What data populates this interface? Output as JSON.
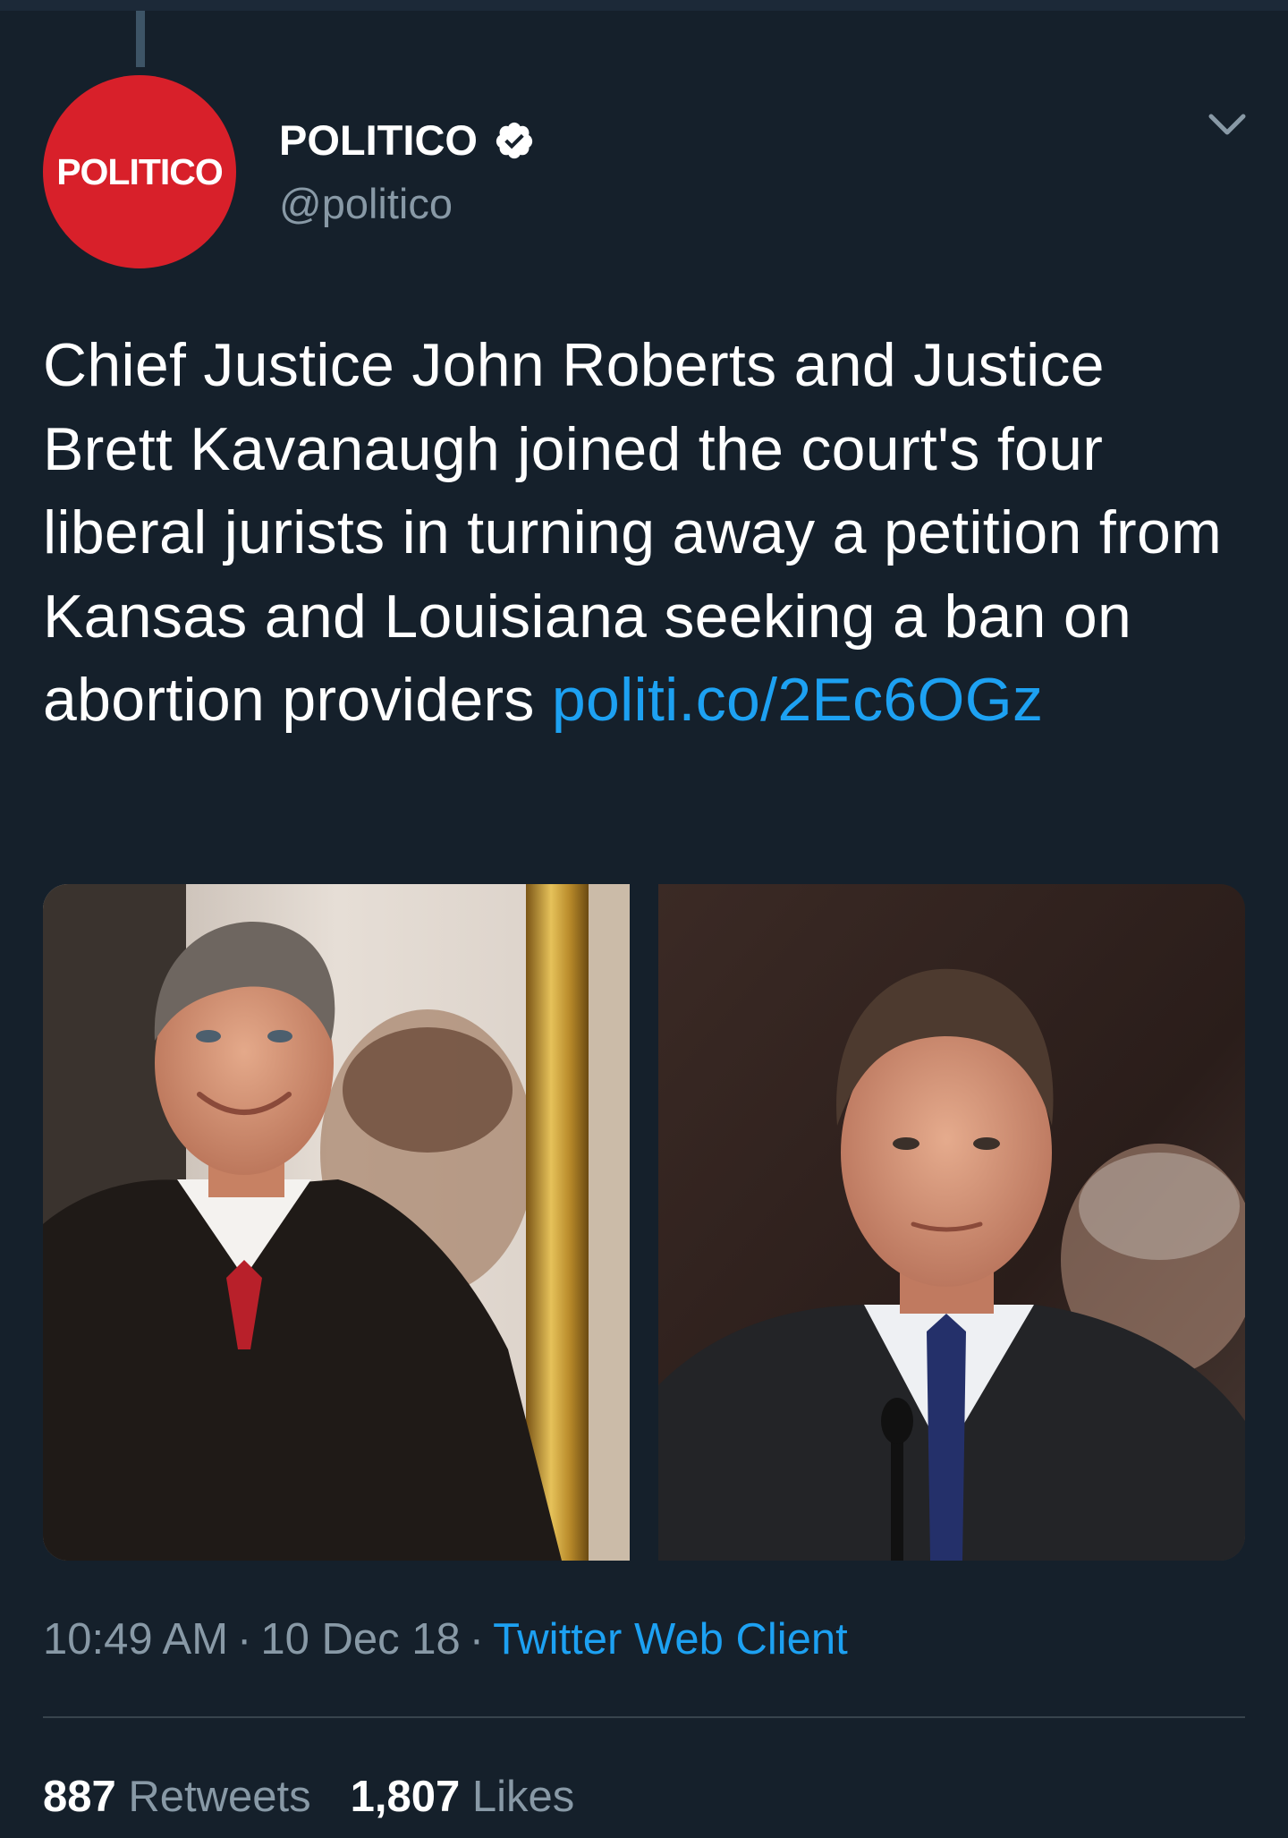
{
  "author": {
    "avatar_text": "POLITICO",
    "name": "POLITICO",
    "handle": "@politico",
    "verified": true
  },
  "tweet": {
    "text": "Chief Justice John Roberts and Justice Brett Kavanaugh joined the court's four liberal jurists in turning away a petition from Kansas and Louisiana seeking a ban on abortion providers ",
    "link": "politi.co/2Ec6OGz"
  },
  "media": [
    {
      "alt": "photo-john-roberts"
    },
    {
      "alt": "photo-brett-kavanaugh"
    }
  ],
  "meta": {
    "time": "10:49 AM",
    "separator": "·",
    "date": "10 Dec 18",
    "client": "Twitter Web Client"
  },
  "stats": {
    "retweets_count": "887",
    "retweets_label": "Retweets",
    "likes_count": "1,807",
    "likes_label": "Likes"
  },
  "colors": {
    "background": "#15202b",
    "link": "#1da1f2",
    "secondary_text": "#8899a6",
    "avatar_brand": "#d8202a"
  },
  "icons": [
    "verified-badge-icon",
    "chevron-down-icon"
  ]
}
